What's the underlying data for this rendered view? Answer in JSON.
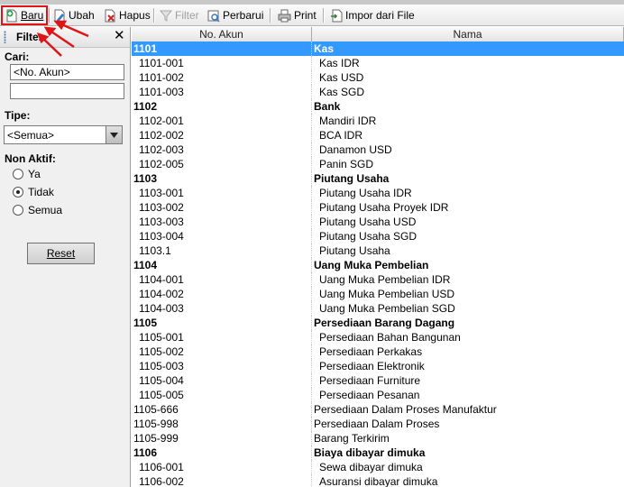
{
  "toolbar": {
    "baru": "Baru",
    "ubah": "Ubah",
    "hapus": "Hapus",
    "filter": "Filter",
    "perbarui": "Perbarui",
    "print": "Print",
    "impor": "Impor dari File"
  },
  "filter_panel": {
    "title": "Filter",
    "close": "✕",
    "cari_label": "Cari:",
    "cari_placeholder": "<No. Akun>",
    "cari_value": "",
    "tipe_label": "Tipe:",
    "tipe_value": "<Semua>",
    "non_aktif_label": "Non Aktif:",
    "radio_ya": "Ya",
    "radio_tidak": "Tidak",
    "radio_semua": "Semua",
    "selected_radio": "Tidak",
    "reset": "Reset"
  },
  "grid": {
    "columns": [
      "No. Akun",
      "Nama"
    ],
    "selected_account": "1101",
    "rows": [
      {
        "no": "1101",
        "nama": "Kas",
        "level": 1
      },
      {
        "no": "1101-001",
        "nama": "Kas IDR",
        "level": 2
      },
      {
        "no": "1101-002",
        "nama": "Kas USD",
        "level": 2
      },
      {
        "no": "1101-003",
        "nama": "Kas SGD",
        "level": 2
      },
      {
        "no": "1102",
        "nama": "Bank",
        "level": 1
      },
      {
        "no": "1102-001",
        "nama": "Mandiri IDR",
        "level": 2
      },
      {
        "no": "1102-002",
        "nama": "BCA IDR",
        "level": 2
      },
      {
        "no": "1102-003",
        "nama": "Danamon USD",
        "level": 2
      },
      {
        "no": "1102-005",
        "nama": "Panin SGD",
        "level": 2
      },
      {
        "no": "1103",
        "nama": "Piutang Usaha",
        "level": 1
      },
      {
        "no": "1103-001",
        "nama": "Piutang Usaha IDR",
        "level": 2
      },
      {
        "no": "1103-002",
        "nama": "Piutang Usaha Proyek IDR",
        "level": 2
      },
      {
        "no": "1103-003",
        "nama": "Piutang Usaha USD",
        "level": 2
      },
      {
        "no": "1103-004",
        "nama": "Piutang Usaha SGD",
        "level": 2
      },
      {
        "no": "1103.1",
        "nama": "Piutang Usaha",
        "level": 2
      },
      {
        "no": "1104",
        "nama": "Uang Muka Pembelian",
        "level": 1
      },
      {
        "no": "1104-001",
        "nama": "Uang Muka Pembelian IDR",
        "level": 2
      },
      {
        "no": "1104-002",
        "nama": "Uang Muka Pembelian USD",
        "level": 2
      },
      {
        "no": "1104-003",
        "nama": "Uang Muka Pembelian SGD",
        "level": 2
      },
      {
        "no": "1105",
        "nama": "Persediaan Barang Dagang",
        "level": 1
      },
      {
        "no": "1105-001",
        "nama": "Persediaan Bahan Bangunan",
        "level": 2
      },
      {
        "no": "1105-002",
        "nama": "Persediaan Perkakas",
        "level": 2
      },
      {
        "no": "1105-003",
        "nama": "Persediaan Elektronik",
        "level": 2
      },
      {
        "no": "1105-004",
        "nama": "Persediaan Furniture",
        "level": 2
      },
      {
        "no": "1105-005",
        "nama": "Persediaan Pesanan",
        "level": 2
      },
      {
        "no": "1105-666",
        "nama": "Persediaan Dalam Proses Manufaktur",
        "level": 0
      },
      {
        "no": "1105-998",
        "nama": "Persediaan Dalam Proses",
        "level": 0
      },
      {
        "no": "1105-999",
        "nama": "Barang Terkirim",
        "level": 0
      },
      {
        "no": "1106",
        "nama": "Biaya dibayar dimuka",
        "level": 1
      },
      {
        "no": "1106-001",
        "nama": "Sewa dibayar dimuka",
        "level": 2
      },
      {
        "no": "1106-002",
        "nama": "Asuransi dibayar dimuka",
        "level": 2
      }
    ]
  },
  "colors": {
    "selection": "#3399ff",
    "highlight_box": "#e01414",
    "annotation_arrow": "#e01414"
  }
}
